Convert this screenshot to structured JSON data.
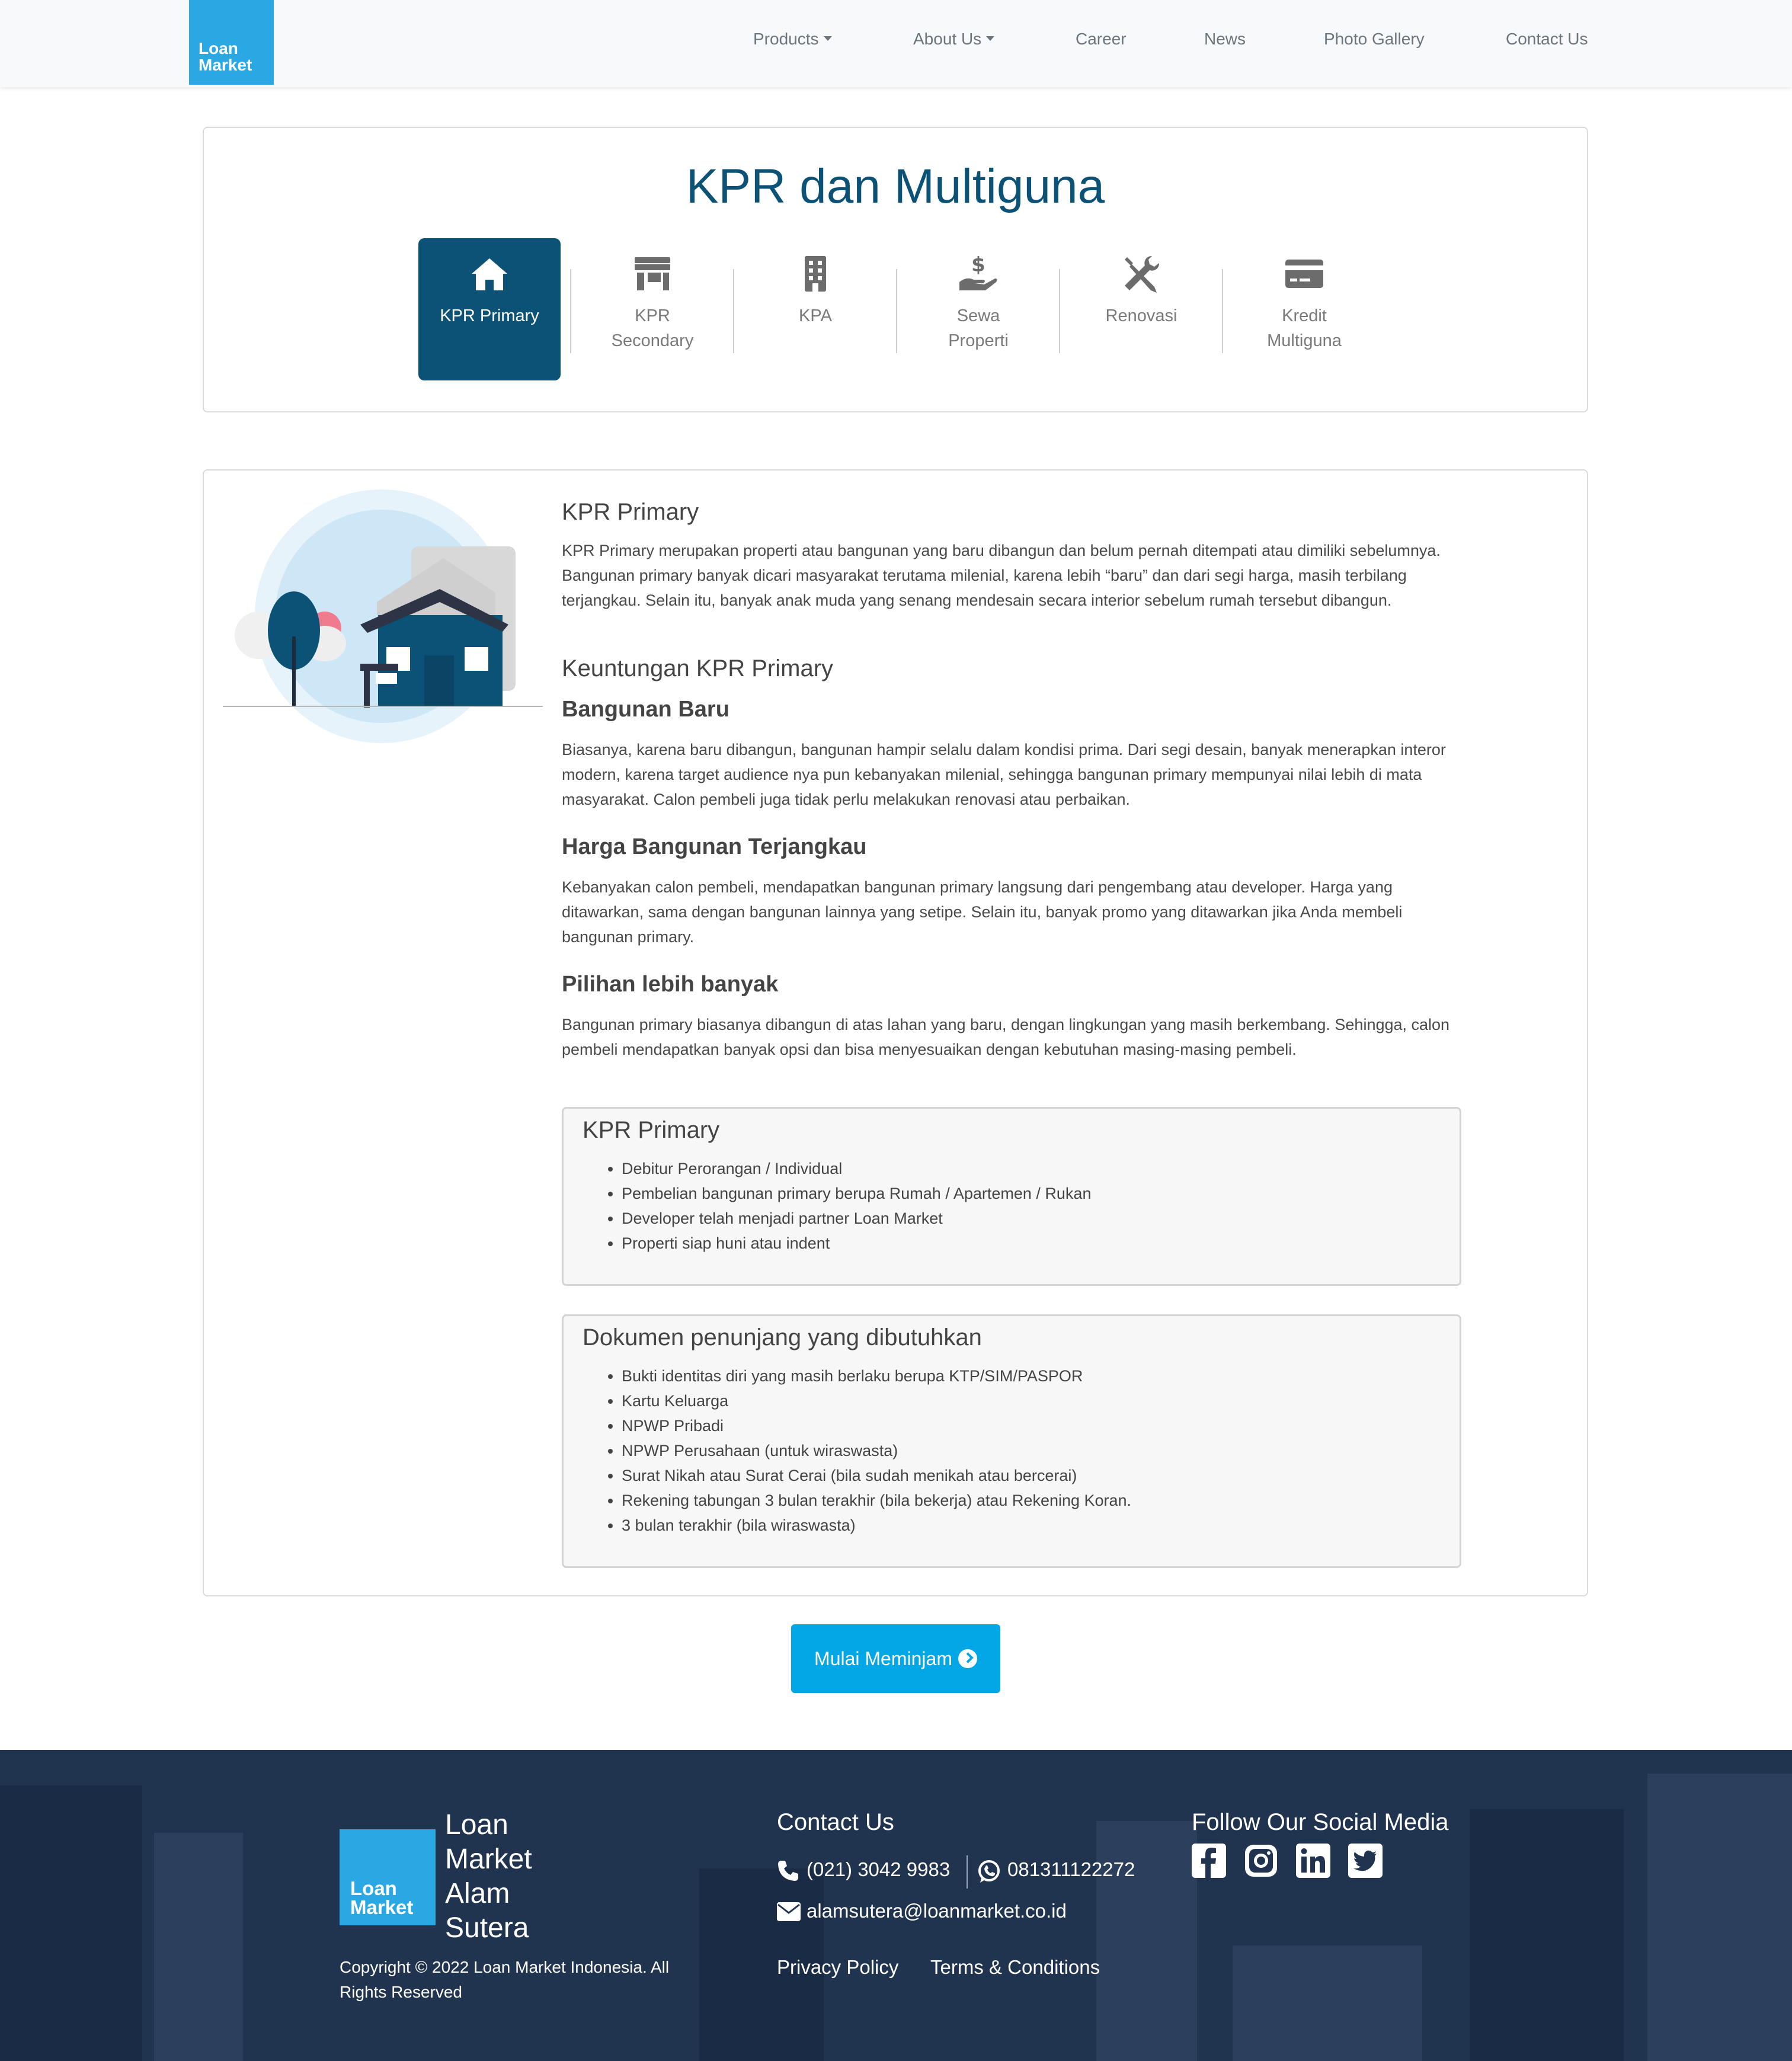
{
  "nav": {
    "logo_line1": "Loan",
    "logo_line2": "Market",
    "items": [
      "Products",
      "About Us",
      "Career",
      "News",
      "Photo Gallery",
      "Contact Us"
    ]
  },
  "header": {
    "title": "KPR dan Multiguna",
    "tabs": [
      {
        "label_1": "KPR Primary",
        "label_2": "",
        "icon": "home-icon",
        "active": true
      },
      {
        "label_1": "KPR",
        "label_2": "Secondary",
        "icon": "store-icon",
        "active": false
      },
      {
        "label_1": "KPA",
        "label_2": "",
        "icon": "building-icon",
        "active": false
      },
      {
        "label_1": "Sewa",
        "label_2": "Properti",
        "icon": "hand-dollar-icon",
        "active": false
      },
      {
        "label_1": "Renovasi",
        "label_2": "",
        "icon": "tools-icon",
        "active": false
      },
      {
        "label_1": "Kredit",
        "label_2": "Multiguna",
        "icon": "credit-card-icon",
        "active": false
      }
    ]
  },
  "detail": {
    "heading": "KPR Primary",
    "intro": "KPR Primary merupakan properti atau bangunan yang baru dibangun dan belum pernah ditempati atau dimiliki sebelumnya. Bangunan primary banyak dicari masyarakat terutama milenial, karena lebih “baru” dan dari segi harga, masih terbilang terjangkau. Selain itu, banyak anak muda yang senang mendesain secara interior sebelum rumah tersebut dibangun.",
    "benefits_heading": "Keuntungan KPR Primary",
    "benefits": [
      {
        "title": "Bangunan Baru",
        "text": "Biasanya, karena baru dibangun, bangunan hampir selalu dalam kondisi prima. Dari segi desain, banyak menerapkan interor modern, karena target audience nya pun kebanyakan milenial, sehingga bangunan primary mempunyai nilai lebih di mata masyarakat. Calon pembeli juga tidak perlu melakukan renovasi atau perbaikan."
      },
      {
        "title": "Harga Bangunan Terjangkau",
        "text": "Kebanyakan calon pembeli, mendapatkan bangunan primary langsung dari pengembang atau developer. Harga yang ditawarkan, sama dengan bangunan lainnya yang setipe. Selain itu, banyak promo yang ditawarkan jika Anda membeli bangunan primary."
      },
      {
        "title": "Pilihan lebih banyak",
        "text": "Bangunan primary biasanya dibangun di atas lahan yang baru, dengan lingkungan yang masih berkembang. Sehingga, calon pembeli mendapatkan banyak opsi dan bisa menyesuaikan dengan kebutuhan masing-masing pembeli."
      }
    ],
    "requirements": {
      "heading": "KPR Primary",
      "items": [
        "Debitur Perorangan / Individual",
        "Pembelian bangunan primary berupa Rumah / Apartemen / Rukan",
        "Developer telah menjadi partner Loan Market",
        "Properti siap huni atau indent"
      ]
    },
    "documents": {
      "heading": "Dokumen penunjang yang dibutuhkan",
      "items": [
        "Bukti identitas diri yang masih berlaku berupa KTP/SIM/PASPOR",
        "Kartu Keluarga",
        "NPWP Pribadi",
        "NPWP Perusahaan (untuk wiraswasta)",
        "Surat Nikah atau Surat Cerai (bila sudah menikah atau bercerai)",
        "Rekening tabungan 3 bulan terakhir (bila bekerja) atau Rekening Koran.",
        "3 bulan terakhir (bila wiraswasta)"
      ]
    }
  },
  "cta": {
    "label": "Mulai Meminjam"
  },
  "footer": {
    "logo_line1": "Loan",
    "logo_line2": "Market",
    "brand_lines": [
      "Loan",
      "Market",
      "Alam",
      "Sutera"
    ],
    "copyright": "Copyright © 2022 Loan Market Indonesia. All Rights Reserved",
    "contact_heading": "Contact Us",
    "phone": "(021) 3042 9983",
    "whatsapp": "081311122272",
    "email": "alamsutera@loanmarket.co.id",
    "privacy": "Privacy Policy",
    "terms": "Terms & Conditions",
    "social_heading": "Follow Our Social Media",
    "social": [
      "facebook-icon",
      "instagram-icon",
      "linkedin-icon",
      "twitter-icon"
    ]
  },
  "colors": {
    "brand_dark": "#0c5277",
    "brand_light": "#2aa8e3",
    "cta": "#04a7e6",
    "footer_bg": "#20334f"
  }
}
